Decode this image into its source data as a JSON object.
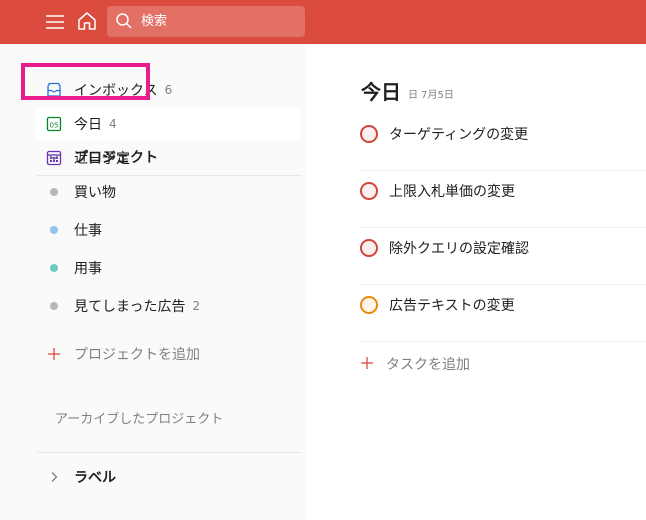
{
  "topbar": {
    "menu_icon": "menu-icon",
    "home_icon": "home-icon",
    "search": {
      "icon": "search-icon",
      "placeholder": "検索"
    }
  },
  "sidebar": {
    "items": [
      {
        "icon": "inbox-icon",
        "label": "インボックス",
        "count": "6"
      },
      {
        "icon": "today-calendar-icon",
        "icon_text": "05",
        "label": "今日",
        "count": "4"
      },
      {
        "icon": "upcoming-calendar-icon",
        "label": "近日予定",
        "count": ""
      }
    ],
    "projects_heading": "プロジェクト",
    "projects": [
      {
        "label": "買い物",
        "color": "#b8b8b8",
        "count": ""
      },
      {
        "label": "仕事",
        "color": "#96c3eb",
        "count": ""
      },
      {
        "label": "用事",
        "color": "#6accbc",
        "count": ""
      },
      {
        "label": "見てしまった広告",
        "color": "#b8b8b8",
        "count": "2"
      }
    ],
    "add_project_label": "プロジェクトを追加",
    "archived_label": "アーカイブしたプロジェクト",
    "labels_heading": "ラベル"
  },
  "main": {
    "title": "今日",
    "date": "日 7月5日",
    "tasks": [
      {
        "label": "ターゲティングの変更",
        "priority_color": "#d1453b"
      },
      {
        "label": "上限入札単価の変更",
        "priority_color": "#d1453b"
      },
      {
        "label": "除外クエリの設定確認",
        "priority_color": "#d1453b"
      },
      {
        "label": "広告テキストの変更",
        "priority_color": "#eb8909"
      }
    ],
    "add_task_label": "タスクを追加"
  },
  "colors": {
    "brand": "#db4c3f",
    "highlight": "#e91e8c",
    "accent_plus": "#db4c3f"
  }
}
